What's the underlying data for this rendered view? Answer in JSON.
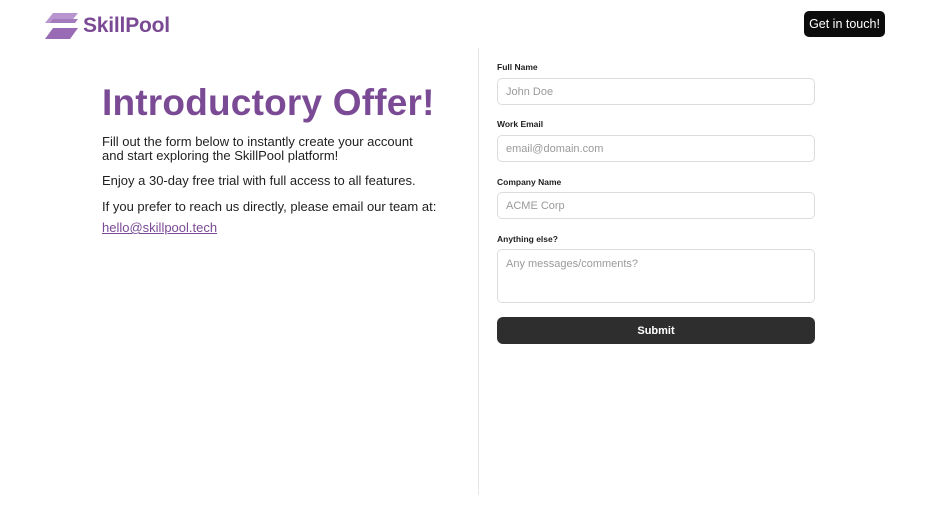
{
  "brand": {
    "name": "SkillPool",
    "logo_icon": "stacked-parallelogram-logo-icon",
    "accent_color": "#7b4a95",
    "accent_light": "#b895cf"
  },
  "header": {
    "cta_label": "Get in touch!"
  },
  "intro": {
    "headline": "Introductory Offer!",
    "paragraph_1": "Fill out the form below to instantly create your account and start exploring the SkillPool platform!",
    "paragraph_2": "Enjoy a 30-day free trial with full access to all features.",
    "paragraph_3": "If you prefer to reach us directly, please email our team at:",
    "email": "hello@skillpool.tech"
  },
  "form": {
    "full_name": {
      "label": "Full Name",
      "placeholder": "John Doe",
      "value": ""
    },
    "work_email": {
      "label": "Work Email",
      "placeholder": "email@domain.com",
      "value": ""
    },
    "company_name": {
      "label": "Company Name",
      "placeholder": "ACME Corp",
      "value": ""
    },
    "anything_else": {
      "label": "Anything else?",
      "placeholder": "Any messages/comments?",
      "value": ""
    },
    "submit_label": "Submit"
  }
}
